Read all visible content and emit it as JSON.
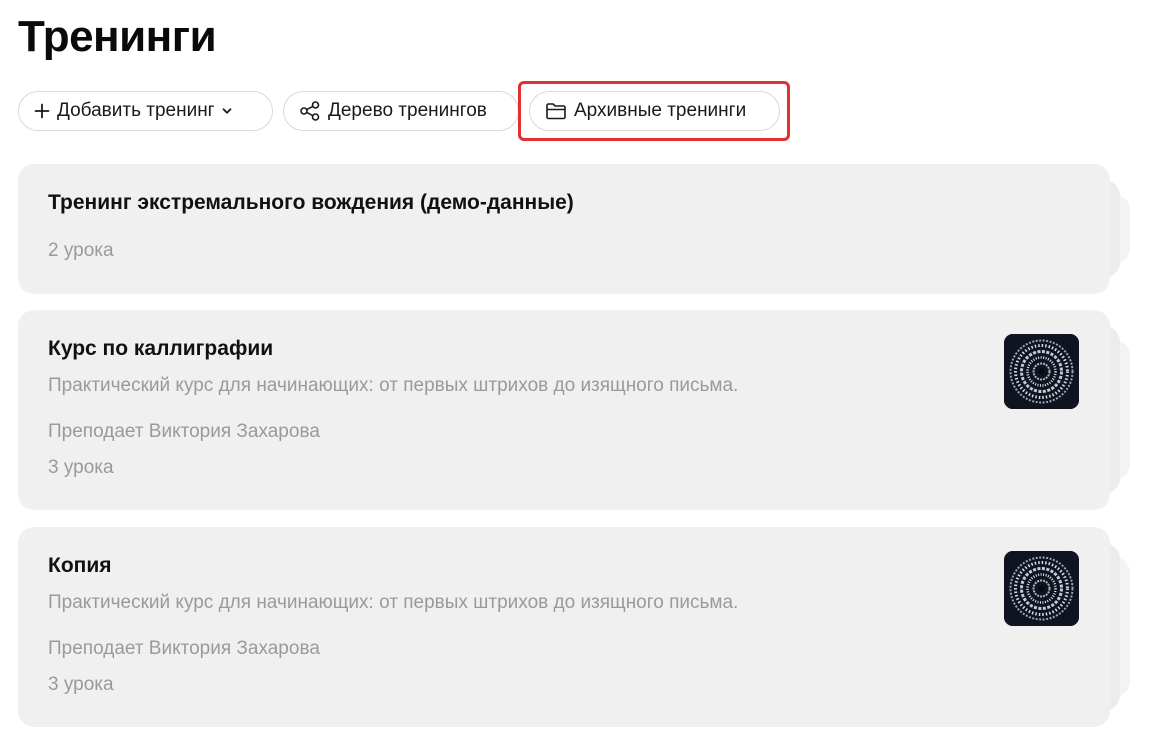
{
  "page": {
    "title": "Тренинги"
  },
  "toolbar": {
    "add_label": "Добавить тренинг",
    "tree_label": "Дерево тренингов",
    "archive_label": "Архивные тренинги"
  },
  "icons": {
    "add": "plus-icon",
    "add_caret": "chevron-down-icon",
    "tree": "share-nodes-icon",
    "archive": "folder-icon",
    "thumbnail": "calligraphy-image"
  },
  "colors": {
    "highlight": "#e0312f",
    "card_bg": "#f0f0f0",
    "muted_text": "#9a9a9a"
  },
  "trainings": [
    {
      "title": "Тренинг экстремального вождения (демо-данные)",
      "lessons": "2 урока"
    },
    {
      "title": "Курс по каллиграфии",
      "description": "Практический курс для начинающих: от первых штрихов до изящного письма.",
      "teacher": "Преподает Виктория Захарова",
      "lessons": "3 урока"
    },
    {
      "title": "Копия",
      "description": "Практический курс для начинающих: от первых штрихов до изящного письма.",
      "teacher": "Преподает Виктория Захарова",
      "lessons": "3 урока"
    }
  ]
}
